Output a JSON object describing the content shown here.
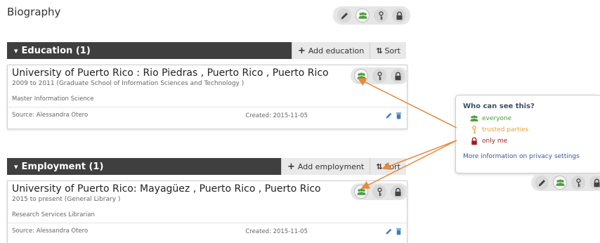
{
  "page": {
    "title": "Biography"
  },
  "icons": {
    "pencil": "pencil-icon",
    "everyone": "group-icon",
    "trusted": "key-icon",
    "only_me": "lock-icon",
    "delete": "trash-icon"
  },
  "colors": {
    "everyone": "#4a9e3b",
    "trusted": "#e6a23c",
    "only_me": "#9b1e1e",
    "link": "#3b5998"
  },
  "education": {
    "header": "Education (1)",
    "add_label": "Add education",
    "sort_label": "Sort",
    "item": {
      "title": "University of Puerto Rico : Rio Piedras , Puerto Rico , Puerto Rico",
      "dates": "2009 to 2011 (Graduate School of Information Sciences and Technology )",
      "role": "Master Information Science",
      "source": "Source: Alessandra Otero",
      "created": "Created: 2015-11-05"
    }
  },
  "employment": {
    "header": "Employment (1)",
    "add_label": "Add employment",
    "sort_label": "Sort",
    "item": {
      "title": "University of Puerto Rico: Mayagüez , Puerto Rico , Puerto Rico",
      "dates": "2015 to present (General Library )",
      "role": "Research Services Librarian",
      "source": "Source: Alessandra Otero",
      "created": "Created: 2015-11-05"
    }
  },
  "popup": {
    "heading": "Who can see this?",
    "options": [
      "everyone",
      "trusted parties",
      "only me"
    ],
    "link": "More information on privacy settings"
  }
}
